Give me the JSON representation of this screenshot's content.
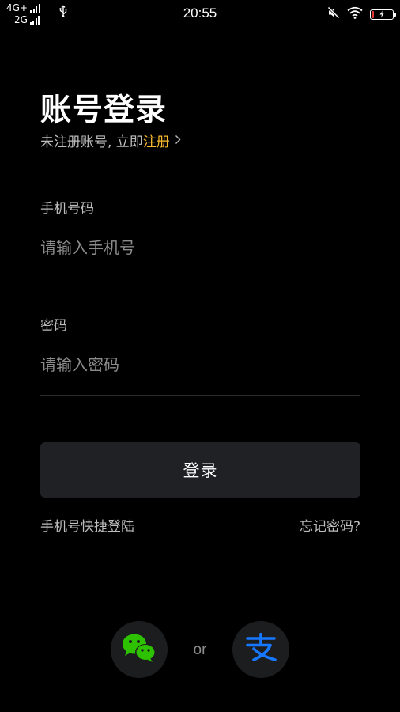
{
  "status_bar": {
    "network_primary": "4G+",
    "network_secondary": "2G",
    "time": "20:55",
    "battery_level": 0.1
  },
  "login": {
    "title": "账号登录",
    "subtitle_prefix": "未注册账号, 立即",
    "register_link": "注册"
  },
  "phone_field": {
    "label": "手机号码",
    "placeholder": "请输入手机号",
    "value": ""
  },
  "password_field": {
    "label": "密码",
    "placeholder": "请输入密码",
    "value": ""
  },
  "actions": {
    "login_button": "登录",
    "quick_login": "手机号快捷登陆",
    "forgot_password": "忘记密码?"
  },
  "social": {
    "or_text": "or",
    "icons": [
      "wechat-icon",
      "alipay-icon"
    ],
    "wechat_color": "#2dc100",
    "alipay_color": "#1677ff"
  },
  "colors": {
    "background": "#000000",
    "accent": "#f5b82e",
    "button_bg": "#1f2124"
  }
}
